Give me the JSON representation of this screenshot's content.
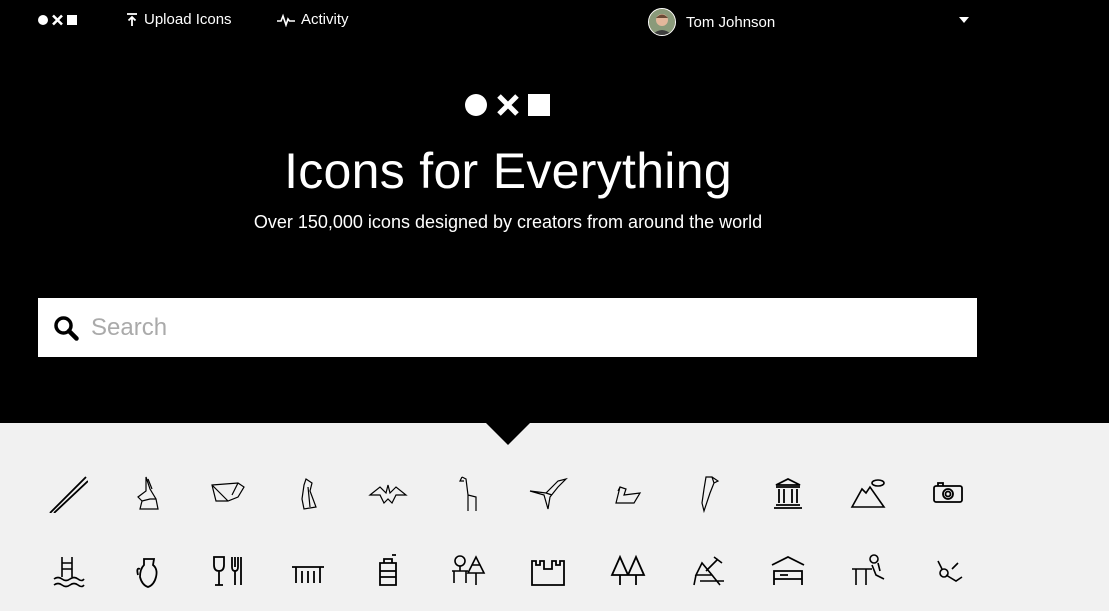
{
  "nav": {
    "upload_label": "Upload Icons",
    "activity_label": "Activity",
    "user_name": "Tom Johnson"
  },
  "hero": {
    "title": "Icons for Everything",
    "subtitle": "Over 150,000 icons designed by creators from around the world"
  },
  "search": {
    "placeholder": "Search"
  },
  "icons": {
    "row1": [
      "chopsticks-icon",
      "origami-rabbit-icon",
      "origami-pig-icon",
      "origami-penguin-icon",
      "origami-bat-icon",
      "origami-giraffe-icon",
      "origami-bird-icon",
      "origami-duck-icon",
      "origami-parrot-icon",
      "museum-icon",
      "mountain-icon",
      "camera-icon"
    ],
    "row2": [
      "swimming-pool-icon",
      "vase-icon",
      "restaurant-icon",
      "table-icon",
      "water-tower-icon",
      "park-icon",
      "castle-icon",
      "trees-icon",
      "beach-chair-icon",
      "hotel-icon",
      "massage-icon",
      "diving-icon"
    ]
  },
  "colors": {
    "hero_bg": "#000000",
    "grid_bg": "#f1f1f1",
    "text": "#ffffff"
  }
}
